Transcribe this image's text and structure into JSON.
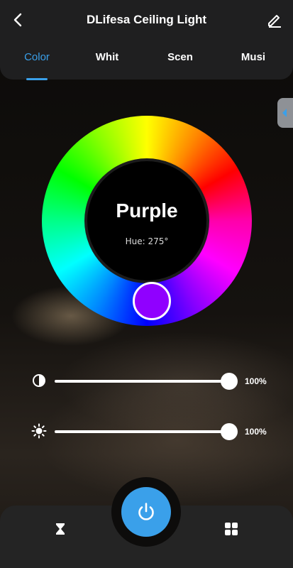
{
  "header": {
    "title": "DLifesa Ceiling Light",
    "tabs": [
      "Color",
      "Whit",
      "Scen",
      "Musi"
    ],
    "active_tab": "Color"
  },
  "color_wheel": {
    "color_name": "Purple",
    "hue_text": "Hue: 275°",
    "selected_color": "#9000ff"
  },
  "sliders": {
    "contrast": {
      "value_text": "100%",
      "level": 1.0
    },
    "brightness": {
      "value_text": "100%",
      "level": 1.0
    }
  },
  "colors": {
    "accent": "#3aa0ea",
    "header_bg": "#1f1f20",
    "bottom_bg": "#242424"
  },
  "icons": {
    "back": "chevron-left-icon",
    "edit": "pencil-icon",
    "contrast": "contrast-icon",
    "brightness": "sun-icon",
    "power": "power-icon",
    "timer": "hourglass-icon",
    "scenes": "grid-icon"
  }
}
